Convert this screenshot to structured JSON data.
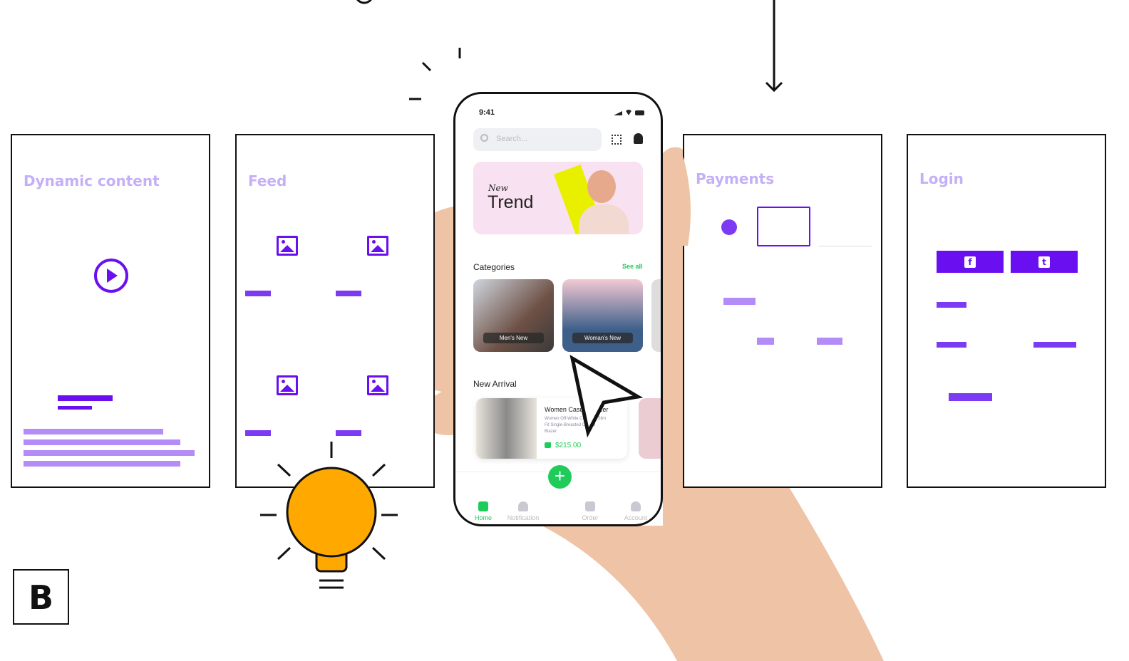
{
  "wireframes": {
    "dynamic_content": {
      "title": "Dynamic content",
      "icon": "play-icon"
    },
    "feed": {
      "title": "Feed",
      "icon": "image-icon"
    },
    "payments": {
      "title": "Payments"
    },
    "login": {
      "title": "Login",
      "buttons": [
        {
          "icon": "facebook-icon",
          "glyph": "f"
        },
        {
          "icon": "twitter-icon",
          "glyph": "t"
        }
      ]
    }
  },
  "phone": {
    "status_time": "9:41",
    "search_placeholder": "Search...",
    "banner": {
      "kicker": "New",
      "title": "Trend"
    },
    "categories": {
      "heading": "Categories",
      "see_all": "See all",
      "items": [
        {
          "label": "Men's New"
        },
        {
          "label": "Woman's New"
        }
      ]
    },
    "new_arrival": {
      "heading": "New Arrival",
      "product": {
        "name": "Women Casual Blazer",
        "description": "Women Off-White Checked Slim Fit Single-Breasted Casual Blazer",
        "price": "$215.00"
      }
    },
    "nav": [
      {
        "label": "Home",
        "icon": "store-icon",
        "active": true
      },
      {
        "label": "Notification",
        "icon": "bell-icon"
      },
      {
        "label": "Order",
        "icon": "bag-icon"
      },
      {
        "label": "Account",
        "icon": "user-icon"
      }
    ]
  },
  "logo": {
    "text": "B"
  },
  "colors": {
    "accent": "#6a0ff0",
    "accent_light": "#b48cf7",
    "green": "#1fcc5a",
    "bulb": "#ffa800",
    "skin": "#f1c6a9"
  }
}
